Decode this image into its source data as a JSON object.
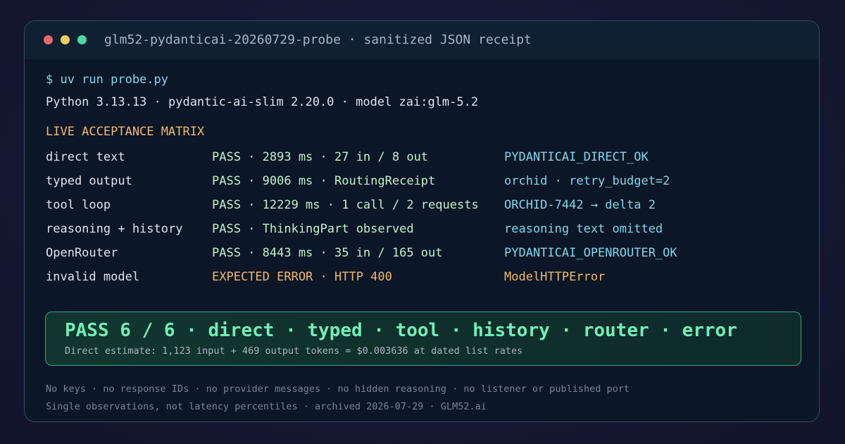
{
  "window": {
    "title": "glm52-pydanticai-20260729-probe · sanitized JSON receipt"
  },
  "terminal": {
    "command": "$ uv run probe.py",
    "environment": "Python 3.13.13 · pydantic-ai-slim 2.20.0 · model zai:glm-5.2",
    "section_title": "LIVE ACCEPTANCE MATRIX",
    "rows": [
      {
        "name": "direct text",
        "status": "PASS · 2893 ms · 27 in / 8 out",
        "detail": "PYDANTICAI_DIRECT_OK"
      },
      {
        "name": "typed output",
        "status": "PASS · 9006 ms · RoutingReceipt",
        "detail": "orchid · retry_budget=2"
      },
      {
        "name": "tool loop",
        "status": "PASS · 12229 ms · 1 call / 2 requests",
        "detail": "ORCHID-7442 → delta 2"
      },
      {
        "name": "reasoning + history",
        "status": "PASS · ThinkingPart observed",
        "detail": "reasoning text omitted"
      },
      {
        "name": "OpenRouter",
        "status": "PASS · 8443 ms · 35 in / 165 out",
        "detail": "PYDANTICAI_OPENROUTER_OK"
      },
      {
        "name": "invalid model",
        "status": "EXPECTED ERROR · HTTP 400",
        "detail": "ModelHTTPError"
      }
    ],
    "summary": {
      "headline": "PASS 6 / 6 · direct · typed · tool · history · router · error",
      "estimate": "Direct estimate: 1,123 input + 469 output tokens = $0.003636 at dated list rates"
    },
    "footer": [
      "No keys · no response IDs · no provider messages · no hidden reasoning · no listener or published port",
      "Single observations, not latency percentiles · archived 2026-07-29 · GLM52.ai"
    ]
  },
  "colors": {
    "background": "#151833",
    "window": "#0b1626",
    "titlebar": "#0f2033",
    "pass": "#bff3cf",
    "detail": "#7fd8ee",
    "warning": "#f4b86a",
    "summary_accent": "#6ff0b8"
  },
  "icons": [
    "close-dot-icon",
    "minimize-dot-icon",
    "maximize-dot-icon"
  ]
}
